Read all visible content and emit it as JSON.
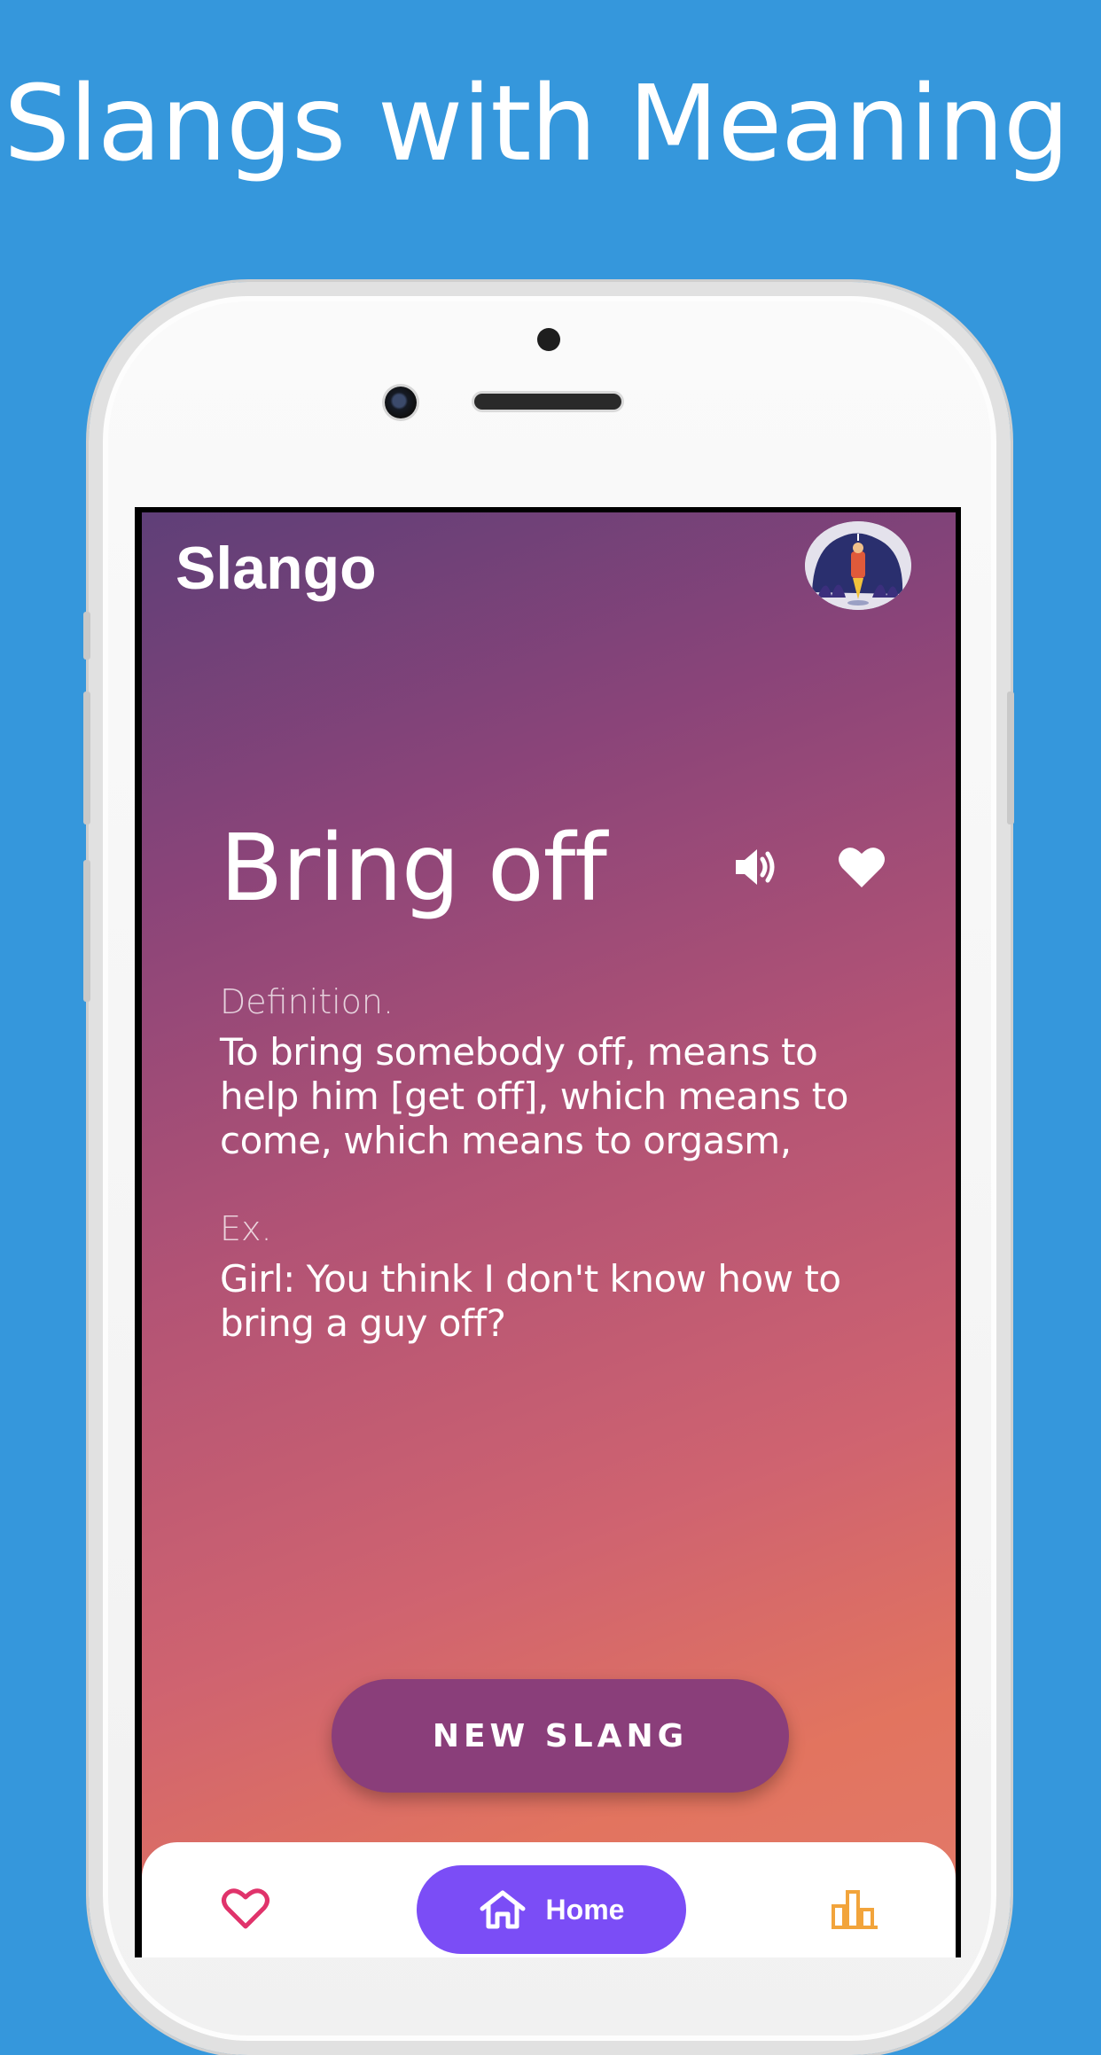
{
  "headline": "Slangs with Meaning",
  "app": {
    "title": "Slango"
  },
  "slang": {
    "word": "Bring off",
    "definition_label": "Definition.",
    "definition": "To bring somebody off, means to help him [get off], which means to come, which means to orgasm,",
    "example_label": "Ex.",
    "example": "Girl: You think I don't know how to bring a guy off?"
  },
  "actions": {
    "new_slang_label": "NEW  SLANG",
    "speaker_icon": "speaker-icon",
    "favorite_icon": "heart-icon"
  },
  "bottom_nav": {
    "items": [
      {
        "icon": "heart-outline-icon",
        "label": ""
      },
      {
        "icon": "home-icon",
        "label": "Home"
      },
      {
        "icon": "bar-chart-icon",
        "label": ""
      }
    ]
  },
  "colors": {
    "background": "#3597dc",
    "accent_purple": "#7b4df6",
    "button_purple": "#8a3e7a",
    "heart_pink": "#e0336b",
    "chart_gold": "#f2a43b"
  }
}
